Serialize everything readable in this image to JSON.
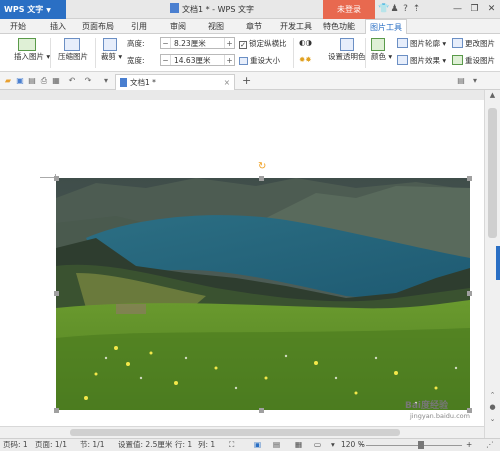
{
  "titlebar": {
    "app_name": "WPS 文字",
    "doc_title": "文档1 * - WPS 文字",
    "login": "未登录",
    "controls": [
      "—",
      "❐",
      "✕"
    ]
  },
  "menu": [
    "开始",
    "插入",
    "页面布局",
    "引用",
    "审阅",
    "视图",
    "章节",
    "开发工具",
    "特色功能",
    "图片工具"
  ],
  "ribbon": {
    "insert_picture": "插入图片",
    "compress_picture": "压缩图片",
    "crop": "裁剪",
    "height_label": "高度:",
    "height_value": "8.23厘米",
    "width_label": "宽度:",
    "width_value": "14.63厘米",
    "lock_ratio": "锁定纵横比",
    "reset_size": "重设大小",
    "set_transparent": "设置透明色",
    "color": "颜色",
    "picture_outline": "图片轮廓",
    "picture_effects": "图片效果",
    "change_picture": "更改图片",
    "reset_picture": "重设图片"
  },
  "quickbar": {
    "tab_title": "文档1 *",
    "add_tab": "+"
  },
  "status": {
    "page": "页码: 1",
    "pages": "页面: 1/1",
    "section": "节: 1/1",
    "setting": "设置值: 2.5厘米",
    "row": "行: 1",
    "col": "列: 1",
    "zoom": "120 %"
  },
  "watermark": {
    "main": "Bai度经验",
    "sub": "jingyan.baidu.com"
  },
  "colors": {
    "accent": "#2a6fc4",
    "login": "#e8694f",
    "handle_orange": "#f0a020"
  }
}
